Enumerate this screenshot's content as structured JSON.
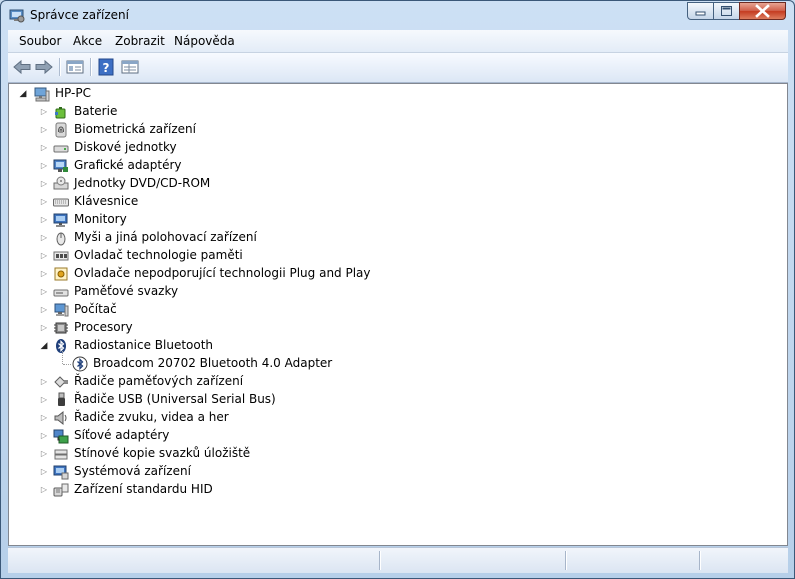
{
  "window": {
    "title": "Správce zařízení",
    "icon": "device-manager-icon"
  },
  "menu": [
    "Soubor",
    "Akce",
    "Zobrazit",
    "Nápověda"
  ],
  "toolbar": [
    "back-arrow-icon",
    "forward-arrow-icon",
    "properties-view-icon",
    "help-icon",
    "details-view-icon"
  ],
  "tree": {
    "root": "HP-PC",
    "items": [
      {
        "label": "Baterie",
        "icon": "battery-icon",
        "expanded": false
      },
      {
        "label": "Biometrická zařízení",
        "icon": "fingerprint-icon",
        "expanded": false
      },
      {
        "label": "Diskové jednotky",
        "icon": "disk-drive-icon",
        "expanded": false
      },
      {
        "label": "Grafické adaptéry",
        "icon": "display-adapter-icon",
        "expanded": false
      },
      {
        "label": "Jednotky DVD/CD-ROM",
        "icon": "dvd-drive-icon",
        "expanded": false
      },
      {
        "label": "Klávesnice",
        "icon": "keyboard-icon",
        "expanded": false
      },
      {
        "label": "Monitory",
        "icon": "monitor-icon",
        "expanded": false
      },
      {
        "label": "Myši a jiná polohovací zařízení",
        "icon": "mouse-icon",
        "expanded": false
      },
      {
        "label": "Ovladač technologie paměti",
        "icon": "memory-controller-icon",
        "expanded": false
      },
      {
        "label": "Ovladače nepodporující technologii Plug and Play",
        "icon": "non-pnp-driver-icon",
        "expanded": false
      },
      {
        "label": "Paměťové svazky",
        "icon": "storage-volume-icon",
        "expanded": false
      },
      {
        "label": "Počítač",
        "icon": "computer-icon",
        "expanded": false
      },
      {
        "label": "Procesory",
        "icon": "processor-icon",
        "expanded": false
      },
      {
        "label": "Radiostanice Bluetooth",
        "icon": "bluetooth-icon",
        "expanded": true,
        "children": [
          {
            "label": "Broadcom 20702 Bluetooth 4.0 Adapter",
            "icon": "bluetooth-adapter-icon"
          }
        ]
      },
      {
        "label": "Řadiče paměťových zařízení",
        "icon": "storage-controller-icon",
        "expanded": false
      },
      {
        "label": "Řadiče USB (Universal Serial Bus)",
        "icon": "usb-icon",
        "expanded": false
      },
      {
        "label": "Řadiče zvuku, videa a her",
        "icon": "speaker-icon",
        "expanded": false
      },
      {
        "label": "Síťové adaptéry",
        "icon": "network-adapter-icon",
        "expanded": false
      },
      {
        "label": "Stínové kopie svazků úložiště",
        "icon": "shadow-copy-icon",
        "expanded": false
      },
      {
        "label": "Systémová zařízení",
        "icon": "system-device-icon",
        "expanded": false
      },
      {
        "label": "Zařízení standardu HID",
        "icon": "hid-icon",
        "expanded": false
      }
    ]
  },
  "colors": {
    "titlebar": "#cde0f4",
    "close_button": "#c43b20",
    "content_bg": "#ffffff"
  }
}
